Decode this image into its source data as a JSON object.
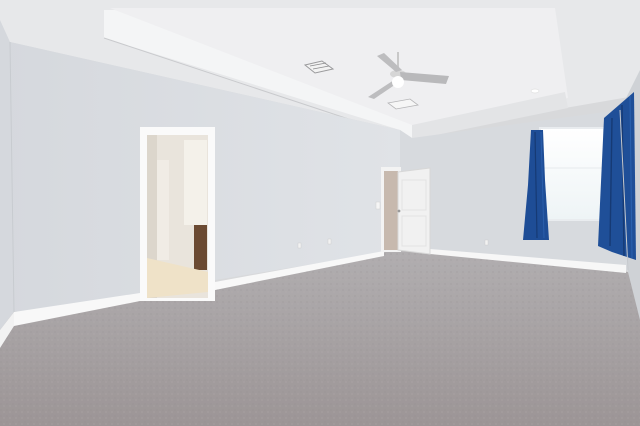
{
  "scene": {
    "description_visible_text": "",
    "colors": {
      "ceiling": "#e9eaec",
      "tray": "#f3f4f6",
      "wall_left": "#dcdfe3",
      "wall_back": "#d9dce0",
      "wall_right": "#d3d6da",
      "carpet": "#a49e9f",
      "baseboard": "#f7f7f7",
      "curtain": "#1f4f97",
      "window": "#f7fbfd",
      "door": "#f2f2f2",
      "bath_floor": "#efe2c8"
    }
  }
}
